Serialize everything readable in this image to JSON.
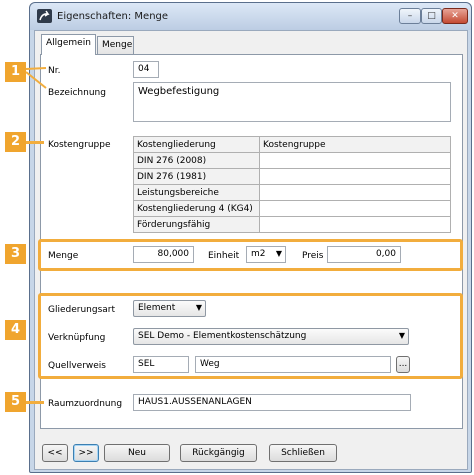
{
  "window": {
    "title": "Eigenschaften: Menge",
    "min_glyph": "–",
    "max_glyph": "□",
    "close_glyph": "✕"
  },
  "tabs": [
    "Allgemein",
    "Menge"
  ],
  "callouts": [
    "1",
    "2",
    "3",
    "4",
    "5"
  ],
  "form": {
    "nr_label": "Nr.",
    "nr_value": "04",
    "bezeichnung_label": "Bezeichnung",
    "bezeichnung_value": "Wegbefestigung",
    "kostengruppe_label": "Kostengruppe",
    "grid": {
      "headers": [
        "Kostengliederung",
        "Kostengruppe"
      ],
      "rows": [
        [
          "DIN 276 (2008)",
          ""
        ],
        [
          "DIN 276 (1981)",
          ""
        ],
        [
          "Leistungsbereiche",
          ""
        ],
        [
          "Kostengliederung 4 (KG4)",
          ""
        ],
        [
          "Förderungsfähig",
          ""
        ]
      ]
    },
    "menge_label": "Menge",
    "menge_value": "80,000",
    "einheit_label": "Einheit",
    "einheit_value": "m2",
    "preis_label": "Preis",
    "preis_value": "0,00",
    "gliederungsart_label": "Gliederungsart",
    "gliederungsart_value": "Element",
    "verknuepfung_label": "Verknüpfung",
    "verknuepfung_value": "SEL Demo - Elementkostenschätzung",
    "quellverweis_label": "Quellverweis",
    "quellverweis_code": "SEL",
    "quellverweis_text": "Weg",
    "browse_label": "...",
    "raumzuordnung_label": "Raumzuordnung",
    "raumzuordnung_value": "HAUS1.AUSSENANLAGEN"
  },
  "buttons": {
    "prev": "<<",
    "next": ">>",
    "neu": "Neu",
    "rueckgaengig": "Rückgängig",
    "schliessen": "Schließen"
  },
  "colors": {
    "callout": "#f0a52e",
    "highlight": "#f2ad3d"
  }
}
